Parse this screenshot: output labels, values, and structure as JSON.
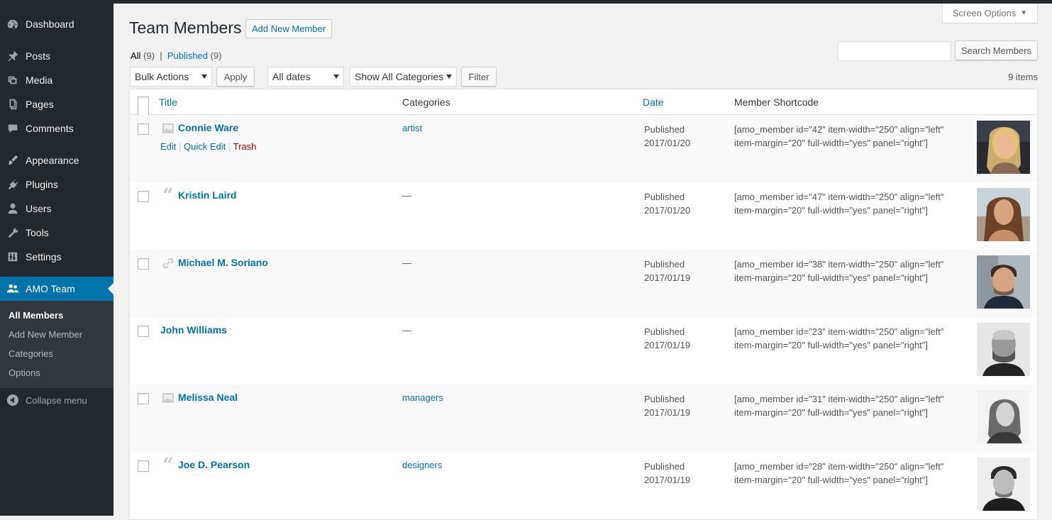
{
  "sidebar": {
    "items": [
      {
        "label": "Dashboard",
        "icon": "dashboard-icon"
      },
      {
        "label": "Posts",
        "icon": "pin-icon"
      },
      {
        "label": "Media",
        "icon": "media-icon"
      },
      {
        "label": "Pages",
        "icon": "pages-icon"
      },
      {
        "label": "Comments",
        "icon": "comment-icon"
      },
      {
        "label": "Appearance",
        "icon": "brush-icon"
      },
      {
        "label": "Plugins",
        "icon": "plugin-icon"
      },
      {
        "label": "Users",
        "icon": "user-icon"
      },
      {
        "label": "Tools",
        "icon": "wrench-icon"
      },
      {
        "label": "Settings",
        "icon": "settings-icon"
      },
      {
        "label": "AMO Team",
        "icon": "groups-icon"
      }
    ],
    "submenu": [
      "All Members",
      "Add New Member",
      "Categories",
      "Options"
    ],
    "collapse": "Collapse menu"
  },
  "header": {
    "screen_options": "Screen Options",
    "title": "Team Members",
    "add_new": "Add New Member"
  },
  "views": {
    "all_label": "All",
    "all_count": "(9)",
    "separator": "|",
    "published_label": "Published",
    "published_count": "(9)"
  },
  "search": {
    "button": "Search Members",
    "value": ""
  },
  "filters": {
    "bulk_actions": "Bulk Actions",
    "apply": "Apply",
    "dates": "All dates",
    "categories": "Show All Categories",
    "filter": "Filter",
    "items_count": "9 items"
  },
  "table": {
    "columns": {
      "title": "Title",
      "categories": "Categories",
      "date": "Date",
      "shortcode": "Member Shortcode"
    },
    "row_actions": {
      "edit": "Edit",
      "quick_edit": "Quick Edit",
      "trash": "Trash"
    },
    "rows": [
      {
        "name": "Connie Ware",
        "format": "image-icon",
        "category": "artist",
        "status": "Published",
        "date": "2017/01/20",
        "shortcode_1": "[amo_member id=\"42\" item-width=\"250\" align=\"left\"",
        "shortcode_2": "item-margin=\"20\" full-width=\"yes\" panel=\"right\"]"
      },
      {
        "name": "Kristin Laird",
        "format": "quote-icon",
        "category": "—",
        "status": "Published",
        "date": "2017/01/20",
        "shortcode_1": "[amo_member id=\"47\" item-width=\"250\" align=\"left\"",
        "shortcode_2": "item-margin=\"20\" full-width=\"yes\" panel=\"right\"]"
      },
      {
        "name": "Michael M. Soriano",
        "format": "link-icon",
        "category": "—",
        "status": "Published",
        "date": "2017/01/19",
        "shortcode_1": "[amo_member id=\"38\" item-width=\"250\" align=\"left\"",
        "shortcode_2": "item-margin=\"20\" full-width=\"yes\" panel=\"right\"]"
      },
      {
        "name": "John Williams",
        "format": "",
        "category": "—",
        "status": "Published",
        "date": "2017/01/19",
        "shortcode_1": "[amo_member id=\"23\" item-width=\"250\" align=\"left\"",
        "shortcode_2": "item-margin=\"20\" full-width=\"yes\" panel=\"right\"]"
      },
      {
        "name": "Melissa Neal",
        "format": "image-icon",
        "category": "managers",
        "status": "Published",
        "date": "2017/01/19",
        "shortcode_1": "[amo_member id=\"31\" item-width=\"250\" align=\"left\"",
        "shortcode_2": "item-margin=\"20\" full-width=\"yes\" panel=\"right\"]"
      },
      {
        "name": "Joe D. Pearson",
        "format": "quote-icon",
        "category": "designers",
        "status": "Published",
        "date": "2017/01/19",
        "shortcode_1": "[amo_member id=\"28\" item-width=\"250\" align=\"left\"",
        "shortcode_2": "item-margin=\"20\" full-width=\"yes\" panel=\"right\"]"
      }
    ]
  },
  "colors": {
    "sidebar_bg": "#23282d",
    "accent": "#0073aa",
    "link": "#0073aa",
    "trash": "#a00000",
    "page_bg": "#f1f1f1"
  }
}
